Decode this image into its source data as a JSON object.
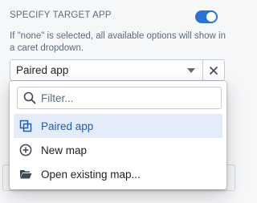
{
  "section": {
    "label": "SPECIFY TARGET APP",
    "toggle_on": true,
    "help": "If \"none\" is selected, all available options will show in a caret dropdown."
  },
  "select": {
    "value": "Paired app"
  },
  "menu": {
    "filter_placeholder": "Filter...",
    "items": [
      {
        "label": "Paired app",
        "icon": "paired-app-icon",
        "active": true
      },
      {
        "label": "New map",
        "icon": "plus-circle-icon",
        "active": false
      },
      {
        "label": "Open existing map...",
        "icon": "folder-open-icon",
        "active": false
      }
    ]
  },
  "colors": {
    "accent": "#2d72d2",
    "active_bg": "#e3ecf8",
    "active_text": "#215db0",
    "muted_text": "#5f6b7c"
  }
}
